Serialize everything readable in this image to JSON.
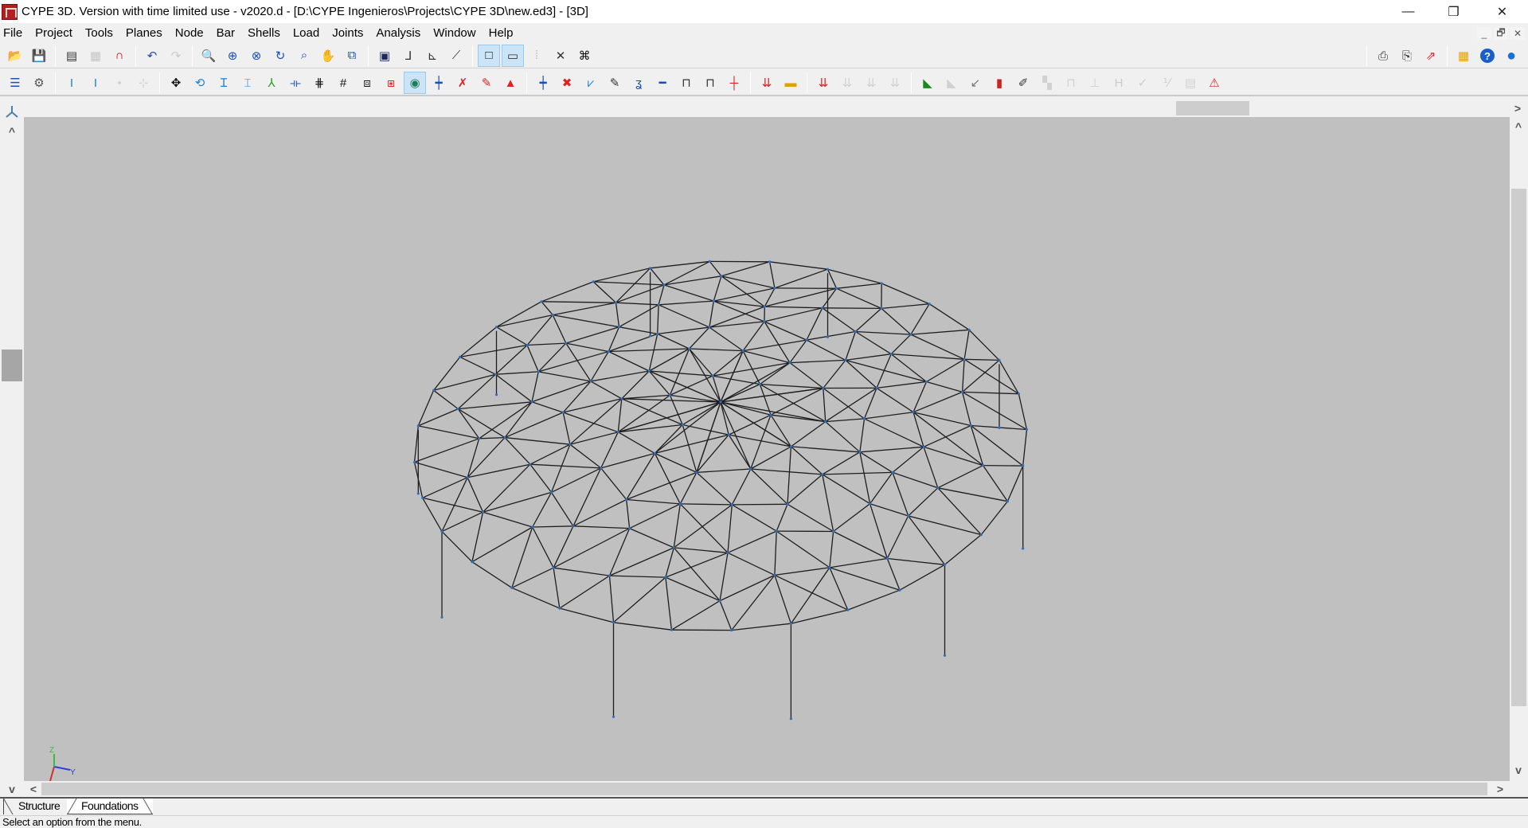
{
  "window": {
    "title": "CYPE 3D. Version with time limited use - v2020.d - [D:\\CYPE Ingenieros\\Projects\\CYPE 3D\\new.ed3] - [3D]",
    "minimize_label": "—",
    "restore_label": "❐",
    "close_label": "✕"
  },
  "menubar": {
    "items": [
      "File",
      "Project",
      "Tools",
      "Planes",
      "Node",
      "Bar",
      "Shells",
      "Load",
      "Joints",
      "Analysis",
      "Window",
      "Help"
    ],
    "mdi_controls": [
      "_",
      "🗗",
      "✕"
    ]
  },
  "toolbar1": {
    "groups": [
      [
        "open-icon",
        "save-icon"
      ],
      [
        "dxf-dwg-import-icon",
        "dxf-dwg-templates-icon",
        "magnet-snap-icon"
      ],
      [
        "undo-icon",
        "redo-icon"
      ],
      [
        "zoom-window-icon",
        "zoom-all-icon",
        "zoom-x2-icon",
        "rotate-view-icon",
        "zoom-previous-icon",
        "pan-hand-icon",
        "view-refresh-icon"
      ],
      [
        "find-view-icon",
        "axes-view-icon",
        "plane-view-icon",
        "dimension-view-icon"
      ],
      [
        "frame-view-icon",
        "scale-1-00-icon",
        "grid-dots-icon",
        "tools-icon",
        "binoculars-icon"
      ]
    ],
    "active": [
      "frame-view-icon",
      "scale-1-00-icon"
    ],
    "disabled": [
      "redo-icon",
      "dxf-dwg-templates-icon",
      "grid-dots-icon"
    ],
    "right_groups": [
      [
        "print-icon",
        "plotter-icon",
        "export-icon"
      ],
      [
        "results-icon",
        "help-icon",
        "web-icon"
      ]
    ]
  },
  "toolbar2": {
    "groups": [
      [
        "description-icon",
        "edit-settings-icon"
      ],
      [
        "new-bar-icon",
        "insert-bar-icon",
        "node-icon",
        "bar-disabled-icon"
      ],
      [
        "move-icon",
        "rotate-icon",
        "bar-section-icon",
        "split-bar-icon",
        "local-axes-icon",
        "dimension-bar-icon",
        "grid-bars-icon",
        "grid-icon",
        "group-icon",
        "delete-group-icon",
        "visibility-eye-icon",
        "add-node-icon",
        "delete-node-icon",
        "edit-node-icon",
        "support-icon"
      ],
      [
        "connect-bar-icon",
        "delete-bar-icon",
        "bracing-icon",
        "describe-bar-icon",
        "buckling-icon",
        "link-bar-icon",
        "describe-member-icon",
        "describe-section-icon",
        "cross-bar-icon"
      ],
      [
        "load-hypothesis-icon",
        "load-panel-icon"
      ],
      [
        "add-load-icon",
        "edit-load-icon",
        "copy-load-icon",
        "delete-load-icon"
      ],
      [
        "new-joint-icon",
        "joint-grey-icon",
        "joint-arrow-icon",
        "joint-red-green-icon",
        "pencil-joint-icon",
        "joint-design-icon",
        "frame-joint-icon",
        "base-plate-icon",
        "h-section-icon",
        "check-joint-icon",
        "fraction-icon",
        "report-icon",
        "warning-icon"
      ]
    ],
    "active": [
      "visibility-eye-icon"
    ],
    "disabled": [
      "node-icon",
      "bar-disabled-icon",
      "edit-load-icon",
      "copy-load-icon",
      "delete-load-icon",
      "joint-grey-icon",
      "joint-design-icon",
      "frame-joint-icon",
      "base-plate-icon",
      "h-section-icon",
      "check-joint-icon",
      "fraction-icon",
      "report-icon"
    ]
  },
  "viewport": {
    "background": "#c0c0c0",
    "line_color": "#1e1e1e",
    "node_color": "#2d6fc4",
    "model": {
      "description": "Triangulated circular shell on columns, 3D view",
      "rings": 6,
      "nodes_per_ring": [
        1,
        6,
        12,
        18,
        24,
        28,
        32
      ],
      "columns": 10
    },
    "axes": {
      "z_label": "Z",
      "y_label": "Y",
      "x_color": "#d03030",
      "y_color": "#2a40d8",
      "z_color": "#3bbd3b"
    },
    "view_axes_icon": "view-axes-icon"
  },
  "scroll": {
    "left": "<",
    "right": ">",
    "up": "^",
    "down": "v"
  },
  "tabs": [
    {
      "label": "Structure",
      "selected": true
    },
    {
      "label": "Foundations",
      "selected": false
    }
  ],
  "status": {
    "text": "Select an option from the menu."
  }
}
